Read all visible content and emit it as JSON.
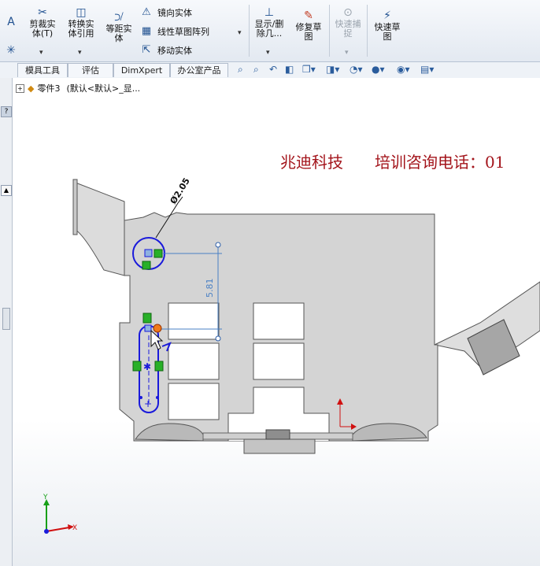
{
  "ribbon": {
    "trim": "剪裁实\n体(T)",
    "convert": "转换实\n体引用",
    "offset": "等距实\n体",
    "mirror": "镜向实体",
    "linear_pattern": "线性草图阵列",
    "move": "移动实体",
    "display_delete": "显示/删\n除几...",
    "repair": "修复草\n图",
    "quick_snap": "快速捕\n捉",
    "rapid_sketch": "快速草\n图"
  },
  "tabs": [
    "模具工具",
    "评估",
    "DimXpert",
    "办公室产品"
  ],
  "tree": {
    "part": "零件3",
    "config": "(默认<默认>_显..."
  },
  "watermark": "兆迪科技　　培训咨询电话：01",
  "dims": {
    "diameter": "Ø2.05",
    "vertical": "5.81"
  },
  "axes": {
    "x": "X",
    "y": "Y"
  }
}
